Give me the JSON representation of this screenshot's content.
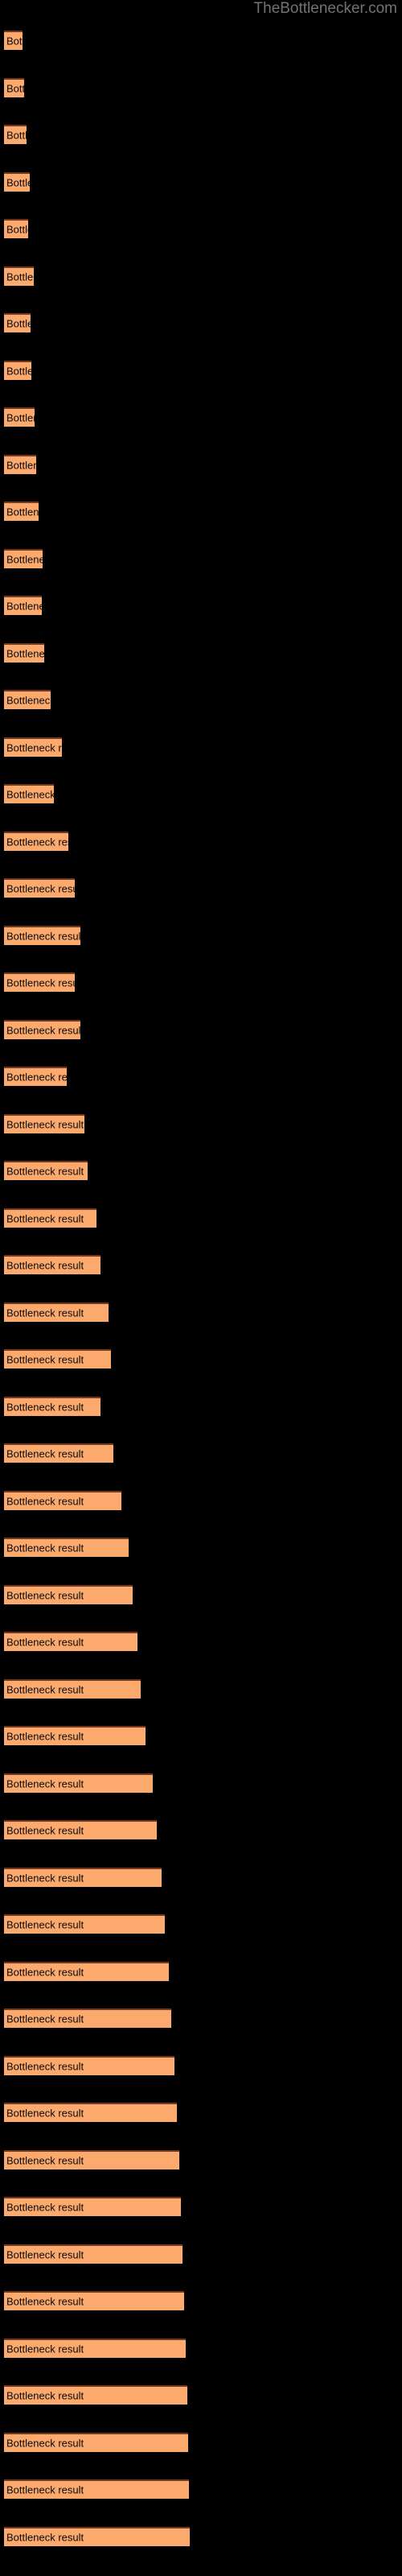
{
  "watermark": {
    "text": "TheBottlenecker.com",
    "color": "#737373"
  },
  "theme": {
    "background": "#000000",
    "bar_fill": "#fca96e",
    "bar_border_top": "#76381a",
    "label_color": "#0b0b0b"
  },
  "chart_data": {
    "type": "bar",
    "orientation": "horizontal",
    "title": "",
    "subtitle": "",
    "xlabel": "",
    "ylabel": "",
    "grid": false,
    "legend": null,
    "axis_visible": false,
    "tick_labels_visible": false,
    "bar_label_template": "Bottleneck result",
    "xlim": [
      0,
      231
    ],
    "note": "Each bar is labelled 'Bottleneck result'; the label text is clipped to the bar width so short bars show only a prefix such as 'Bo', 'Bott', 'Bottlene'.",
    "categories": [
      "Bottleneck result",
      "Bottleneck result",
      "Bottleneck result",
      "Bottleneck result",
      "Bottleneck result",
      "Bottleneck result",
      "Bottleneck result",
      "Bottleneck result",
      "Bottleneck result",
      "Bottleneck result",
      "Bottleneck result",
      "Bottleneck result",
      "Bottleneck result",
      "Bottleneck result",
      "Bottleneck result",
      "Bottleneck result",
      "Bottleneck result",
      "Bottleneck result",
      "Bottleneck result",
      "Bottleneck result",
      "Bottleneck result",
      "Bottleneck result",
      "Bottleneck result",
      "Bottleneck result",
      "Bottleneck result",
      "Bottleneck result",
      "Bottleneck result",
      "Bottleneck result",
      "Bottleneck result",
      "Bottleneck result",
      "Bottleneck result",
      "Bottleneck result",
      "Bottleneck result",
      "Bottleneck result",
      "Bottleneck result",
      "Bottleneck result",
      "Bottleneck result",
      "Bottleneck result",
      "Bottleneck result",
      "Bottleneck result",
      "Bottleneck result",
      "Bottleneck result",
      "Bottleneck result",
      "Bottleneck result",
      "Bottleneck result",
      "Bottleneck result",
      "Bottleneck result",
      "Bottleneck result",
      "Bottleneck result",
      "Bottleneck result",
      "Bottleneck result",
      "Bottleneck result",
      "Bottleneck result",
      "Bottleneck result"
    ],
    "values": [
      23,
      25,
      28,
      32,
      30,
      37,
      33,
      34,
      38,
      40,
      43,
      48,
      47,
      50,
      58,
      72,
      62,
      80,
      88,
      95,
      88,
      95,
      78,
      100,
      104,
      115,
      120,
      130,
      133,
      120,
      136,
      146,
      155,
      160,
      166,
      170,
      176,
      185,
      190,
      196,
      200,
      205,
      208,
      212,
      215,
      218,
      220,
      222,
      224,
      226,
      228,
      229,
      230,
      231
    ]
  }
}
